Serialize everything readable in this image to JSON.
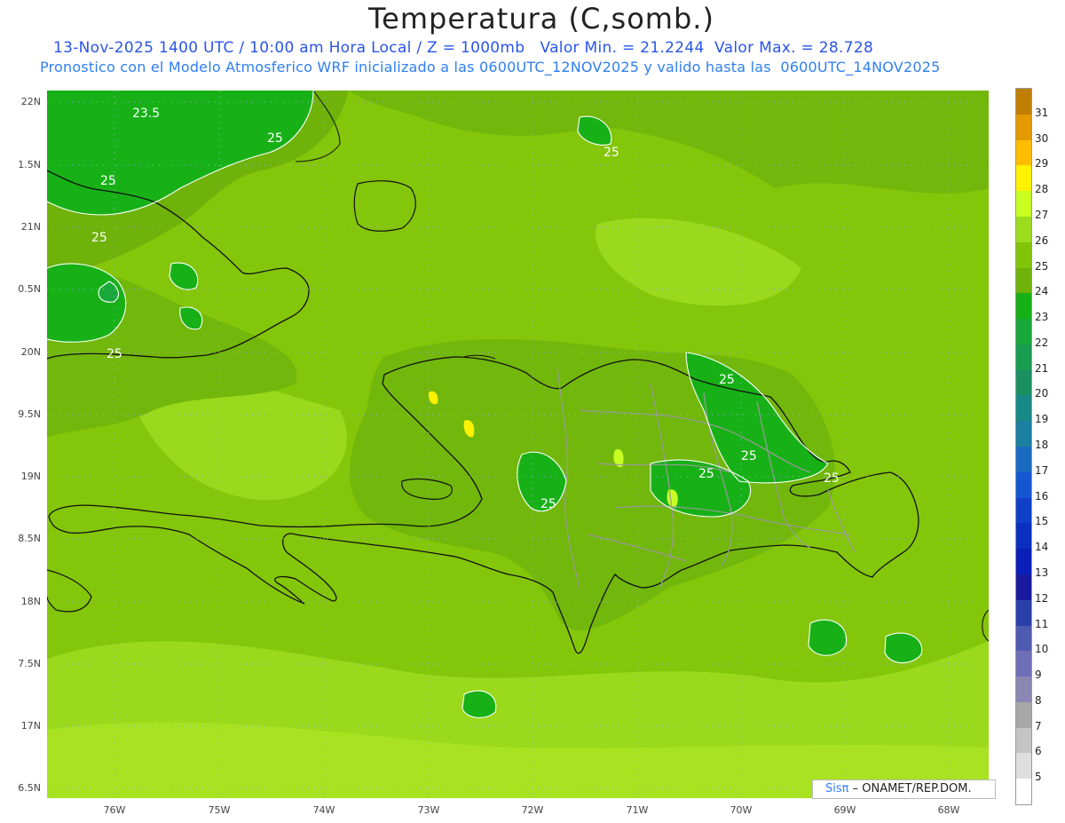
{
  "title": "Temperatura (C,somb.)",
  "subtitle_line1": "13-Nov-2025 1400 UTC / 10:00 am Hora Local / Z = 1000mb   Valor Min. = 21.2244  Valor Max. = 28.728",
  "subtitle_line2": "Pronostico con el Modelo Atmosferico WRF inicializado a las 0600UTC_12NOV2025 y valido hasta las  0600UTC_14NOV2025",
  "lat_labels": [
    "22N",
    "1.5N",
    "21N",
    "0.5N",
    "20N",
    "9.5N",
    "19N",
    "8.5N",
    "18N",
    "7.5N",
    "17N",
    "6.5N"
  ],
  "lon_labels": [
    "76W",
    "75W",
    "74W",
    "73W",
    "72W",
    "71W",
    "70W",
    "69W",
    "68W"
  ],
  "contour_labels": [
    "23.5",
    "25",
    "25",
    "25",
    "25",
    "25",
    "25",
    "25",
    "25",
    "25",
    "25"
  ],
  "colorbar": {
    "labels": [
      "31",
      "30",
      "29",
      "28",
      "27",
      "26",
      "25",
      "24",
      "23",
      "22",
      "21",
      "20",
      "19",
      "18",
      "17",
      "16",
      "15",
      "14",
      "13",
      "12",
      "11",
      "10",
      "9",
      "8",
      "7",
      "6",
      "5"
    ],
    "colors": [
      "#c07e00",
      "#e39900",
      "#ffbd00",
      "#fff200",
      "#c8ff22",
      "#9cdc1e",
      "#82c40a",
      "#6eb20a",
      "#17b117",
      "#19a83a",
      "#1a9b52",
      "#1a8f62",
      "#188a85",
      "#1a7fa0",
      "#1a6ac0",
      "#1557d2",
      "#1040c8",
      "#0b2fbf",
      "#0a1fb8",
      "#1a1aa0",
      "#2b3fa8",
      "#4f5bb0",
      "#6f6fb8",
      "#8c86b2",
      "#a8a8a8",
      "#c4c4c4",
      "#dedede",
      "#ffffff"
    ]
  },
  "credit": {
    "brand": "Sisπ",
    "org": "– ONAMET/REP.DOM."
  }
}
